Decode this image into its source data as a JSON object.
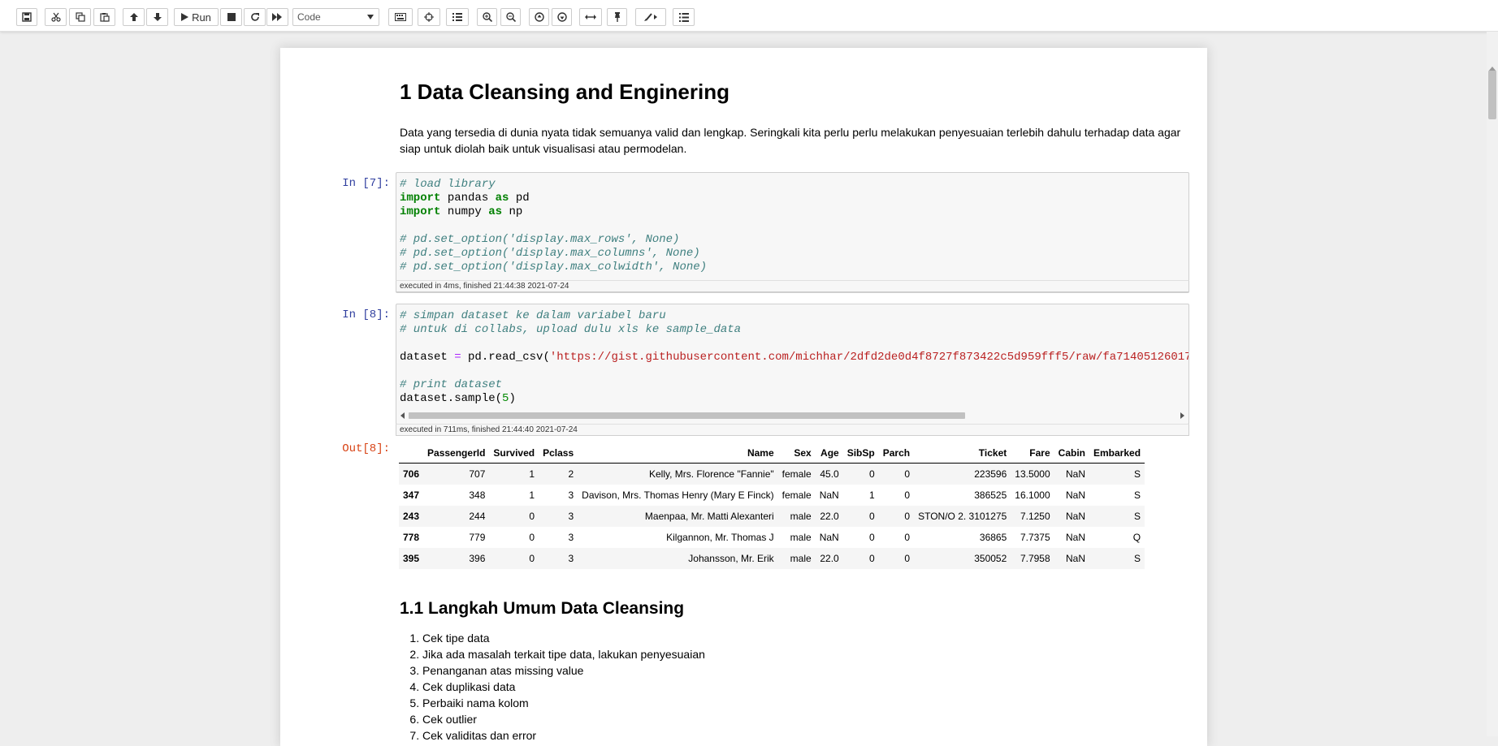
{
  "toolbar": {
    "run_label": "Run",
    "cell_type": "Code",
    "icons": [
      "save-icon",
      "cut-icon",
      "copy-icon",
      "paste-icon",
      "move-up-icon",
      "move-down-icon",
      "run-icon",
      "stop-icon",
      "restart-icon",
      "fast-forward-icon",
      "keyboard-icon",
      "crosshair-icon",
      "numbered-list-icon",
      "zoom-in-icon",
      "zoom-out-icon",
      "arrow-circle-up-icon",
      "arrow-circle-down-icon",
      "arrows-horizontal-icon",
      "pin-icon",
      "paintbrush-icon",
      "list-icon"
    ]
  },
  "notebook": {
    "title": "1  Data Cleansing and Enginering",
    "intro": "Data yang tersedia di dunia nyata tidak semuanya valid dan lengkap. Seringkali kita perlu perlu melakukan penyesuaian terlebih dahulu terhadap data agar siap untuk diolah baik untuk visualisasi atau permodelan.",
    "cell1": {
      "prompt": "In [7]:",
      "lines": [
        {
          "text": "# load library"
        },
        {
          "p1": "import",
          "p2": " pandas ",
          "p3": "as",
          "p4": " pd"
        },
        {
          "p1": "import",
          "p2": " numpy ",
          "p3": "as",
          "p4": " np"
        },
        {
          "text": ""
        },
        {
          "text": "# pd.set_option('display.max_rows', None)"
        },
        {
          "text": "# pd.set_option('display.max_columns', None)"
        },
        {
          "text": "# pd.set_option('display.max_colwidth', None)"
        }
      ],
      "exec": "executed in 4ms, finished 21:44:38 2021-07-24"
    },
    "cell2": {
      "prompt": "In [8]:",
      "comment1": "# simpan dataset ke dalam variabel baru",
      "comment2": "# untuk di collabs, upload dulu xls ke sample_data",
      "assign_var": "dataset ",
      "assign_op": "=",
      "assign_call": " pd.read_csv(",
      "assign_str": "'https://gist.githubusercontent.com/michhar/2dfd2de0d4f8727f873422c5d959fff5/raw/fa71405126017",
      "comment3": "# print dataset",
      "sample_call": "dataset.sample(",
      "sample_arg": "5",
      "sample_close": ")",
      "exec": "executed in 711ms, finished 21:44:40 2021-07-24",
      "out_prompt": "Out[8]:"
    },
    "table": {
      "columns": [
        "",
        "PassengerId",
        "Survived",
        "Pclass",
        "Name",
        "Sex",
        "Age",
        "SibSp",
        "Parch",
        "Ticket",
        "Fare",
        "Cabin",
        "Embarked"
      ],
      "rows": [
        [
          "706",
          "707",
          "1",
          "2",
          "Kelly, Mrs. Florence \"Fannie\"",
          "female",
          "45.0",
          "0",
          "0",
          "223596",
          "13.5000",
          "NaN",
          "S"
        ],
        [
          "347",
          "348",
          "1",
          "3",
          "Davison, Mrs. Thomas Henry (Mary E Finck)",
          "female",
          "NaN",
          "1",
          "0",
          "386525",
          "16.1000",
          "NaN",
          "S"
        ],
        [
          "243",
          "244",
          "0",
          "3",
          "Maenpaa, Mr. Matti Alexanteri",
          "male",
          "22.0",
          "0",
          "0",
          "STON/O 2. 3101275",
          "7.1250",
          "NaN",
          "S"
        ],
        [
          "778",
          "779",
          "0",
          "3",
          "Kilgannon, Mr. Thomas J",
          "male",
          "NaN",
          "0",
          "0",
          "36865",
          "7.7375",
          "NaN",
          "Q"
        ],
        [
          "395",
          "396",
          "0",
          "3",
          "Johansson, Mr. Erik",
          "male",
          "22.0",
          "0",
          "0",
          "350052",
          "7.7958",
          "NaN",
          "S"
        ]
      ]
    },
    "section": {
      "title": "1.1  Langkah Umum Data Cleansing",
      "steps": [
        "Cek tipe data",
        "Jika ada masalah terkait tipe data, lakukan penyesuaian",
        "Penanganan atas missing value",
        "Cek duplikasi data",
        "Perbaiki nama kolom",
        "Cek outlier",
        "Cek validitas dan error"
      ]
    }
  }
}
